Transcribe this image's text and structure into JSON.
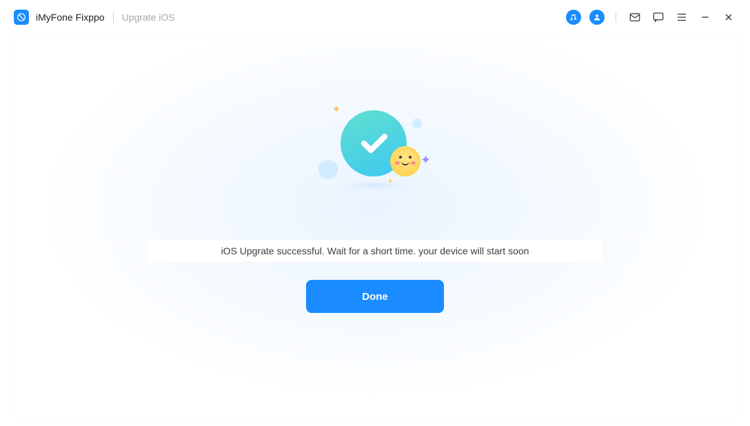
{
  "header": {
    "app_name": "iMyFone Fixppo",
    "breadcrumb": "Upgrate iOS"
  },
  "main": {
    "status_message": "iOS Upgrate successful. Wait for a short time. your device will start soon",
    "done_label": "Done"
  }
}
